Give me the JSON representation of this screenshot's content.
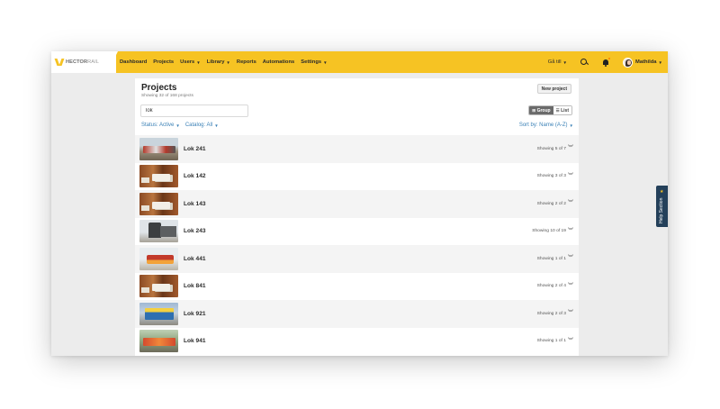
{
  "app": {
    "logo": {
      "text_bold": "HECTOR",
      "text_light": "RAIL"
    },
    "nav": [
      {
        "label": "Dashboard",
        "dropdown": false
      },
      {
        "label": "Projects",
        "dropdown": false
      },
      {
        "label": "Users",
        "dropdown": true
      },
      {
        "label": "Library",
        "dropdown": true
      },
      {
        "label": "Reports",
        "dropdown": false
      },
      {
        "label": "Automations",
        "dropdown": false
      },
      {
        "label": "Settings",
        "dropdown": true
      }
    ],
    "goto_label": "Gå till",
    "user_name": "Mathilda",
    "accent_color": "#f6c323",
    "link_color": "#3a80b6"
  },
  "page": {
    "title": "Projects",
    "subtitle": "Showing 32 of 168 projects",
    "new_button": "New project",
    "search_value": "lok",
    "filters": [
      {
        "label": "Status: Active"
      },
      {
        "label": "Catalog: All"
      }
    ],
    "view_toggle": [
      {
        "label": "Group",
        "icon": "group-icon",
        "active": true
      },
      {
        "label": "List",
        "icon": "list-icon",
        "active": false
      }
    ],
    "sort_label": "Sort by: Name (A-Z)"
  },
  "projects": [
    {
      "name": "Lok 241",
      "count": "Showing 5 of 7",
      "thumb": "yard"
    },
    {
      "name": "Lok 142",
      "count": "Showing 3 of 3",
      "thumb": "wood"
    },
    {
      "name": "Lok 143",
      "count": "Showing 2 of 2",
      "thumb": "wood"
    },
    {
      "name": "Lok 243",
      "count": "Showing 10 of 19",
      "thumb": "grey"
    },
    {
      "name": "Lok 441",
      "count": "Showing 1 of 1",
      "thumb": "red"
    },
    {
      "name": "Lok 841",
      "count": "Showing 2 of 4",
      "thumb": "wood"
    },
    {
      "name": "Lok 921",
      "count": "Showing 2 of 3",
      "thumb": "blue"
    },
    {
      "name": "Lok 941",
      "count": "Showing 1 of 1",
      "thumb": "green"
    }
  ],
  "help": {
    "label": "Help Section"
  }
}
